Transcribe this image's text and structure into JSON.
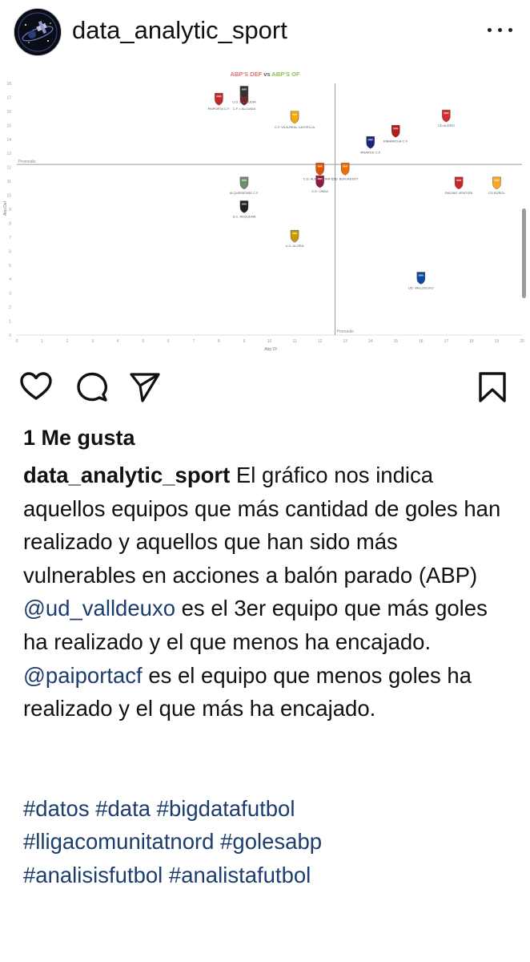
{
  "header": {
    "username": "data_analytic_sport",
    "avatar_icon": "satellite-logo-icon",
    "more_icon": "more-horizontal-icon"
  },
  "post_image": {
    "chart_data": {
      "type": "scatter",
      "title_part1": "ABP'S DEF",
      "title_vs": "vs",
      "title_part2": "ABP'S OF",
      "title_color_1": "#e57373",
      "title_color_2": "#8bc34a",
      "xlabel": "Abp Of",
      "ylabel": "Abp Def",
      "xlim": [
        0,
        20
      ],
      "ylim": [
        0,
        18
      ],
      "x_ticks": [
        "0",
        "1",
        "2",
        "3",
        "4",
        "5",
        "6",
        "7",
        "8",
        "9",
        "10",
        "11",
        "12",
        "13",
        "14",
        "15",
        "16",
        "17",
        "18",
        "19",
        "20"
      ],
      "y_ticks": [
        "0",
        "1",
        "2",
        "3",
        "4",
        "5",
        "6",
        "7",
        "8",
        "9",
        "10",
        "11",
        "12",
        "13",
        "14",
        "15",
        "16",
        "17",
        "18"
      ],
      "avg_x": 12.6,
      "avg_y": 12.2,
      "avg_x_label": "Promedio",
      "avg_y_label": "Promedio",
      "points": [
        {
          "x": 8,
          "y": 16.9,
          "label": "PAIPORTA C.F.",
          "color": "#c62828"
        },
        {
          "x": 9,
          "y": 16.9,
          "label": "C.F. L'ALCUDIA",
          "color": "#7b1f2a"
        },
        {
          "x": 9,
          "y": 17.4,
          "label": "U.D. L'ALCUDIA",
          "color": "#333333"
        },
        {
          "x": 11,
          "y": 15.6,
          "label": "C.F. VILA-REAL CASTELLA",
          "color": "#f2a900"
        },
        {
          "x": 17,
          "y": 15.7,
          "label": "CD ACERO",
          "color": "#d32f2f"
        },
        {
          "x": 15,
          "y": 14.6,
          "label": "RIBARROJA C.F.",
          "color": "#b71c1c"
        },
        {
          "x": 14,
          "y": 13.8,
          "label": "VINAROS C.F.",
          "color": "#1a237e"
        },
        {
          "x": 12,
          "y": 11.9,
          "label": "C.D. ALMASSORA C.F.",
          "color": "#e65100"
        },
        {
          "x": 13,
          "y": 11.9,
          "label": "C.D. BURJASSOT",
          "color": "#ef6c00"
        },
        {
          "x": 12,
          "y": 11.0,
          "label": "C.D. ONDA",
          "color": "#8e1b3a"
        },
        {
          "x": 9,
          "y": 10.9,
          "label": "ALQUERIENSE C.F.",
          "color": "#6d8f6a"
        },
        {
          "x": 17.5,
          "y": 10.9,
          "label": "RACING VENTORI",
          "color": "#c62828"
        },
        {
          "x": 19,
          "y": 10.9,
          "label": "CD BUÑOL",
          "color": "#f9a825"
        },
        {
          "x": 9,
          "y": 9.2,
          "label": "S.C. REQUENA",
          "color": "#212121"
        },
        {
          "x": 11,
          "y": 7.1,
          "label": "U.D. ALZIRA",
          "color": "#c49a00"
        },
        {
          "x": 16,
          "y": 4.1,
          "label": "UD. VALLDEUXO",
          "color": "#0d47a1"
        }
      ]
    }
  },
  "actions": {
    "like_icon": "heart-icon",
    "comment_icon": "comment-icon",
    "share_icon": "send-icon",
    "save_icon": "bookmark-icon"
  },
  "likes": "1 Me gusta",
  "caption": {
    "username": "data_analytic_sport",
    "text": " El gráfico nos indica aquellos equipos que más cantidad de goles han realizado y aquellos que han sido más vulnerables en acciones a balón parado (ABP)",
    "mention1": "@ud_valldeuxo",
    "text2": " es el 3er equipo que más goles ha realizado y el que menos ha encajado.",
    "mention2": "@paiportacf",
    "text3": " es el equipo que menos goles ha realizado y el que más ha encajado.",
    "hashtags_line1": "#datos #data #bigdatafutbol",
    "hashtags_line2": "#lligacomunitatnord #golesabp",
    "hashtags_line3": "#analisisfutbol #analistafutbol"
  }
}
